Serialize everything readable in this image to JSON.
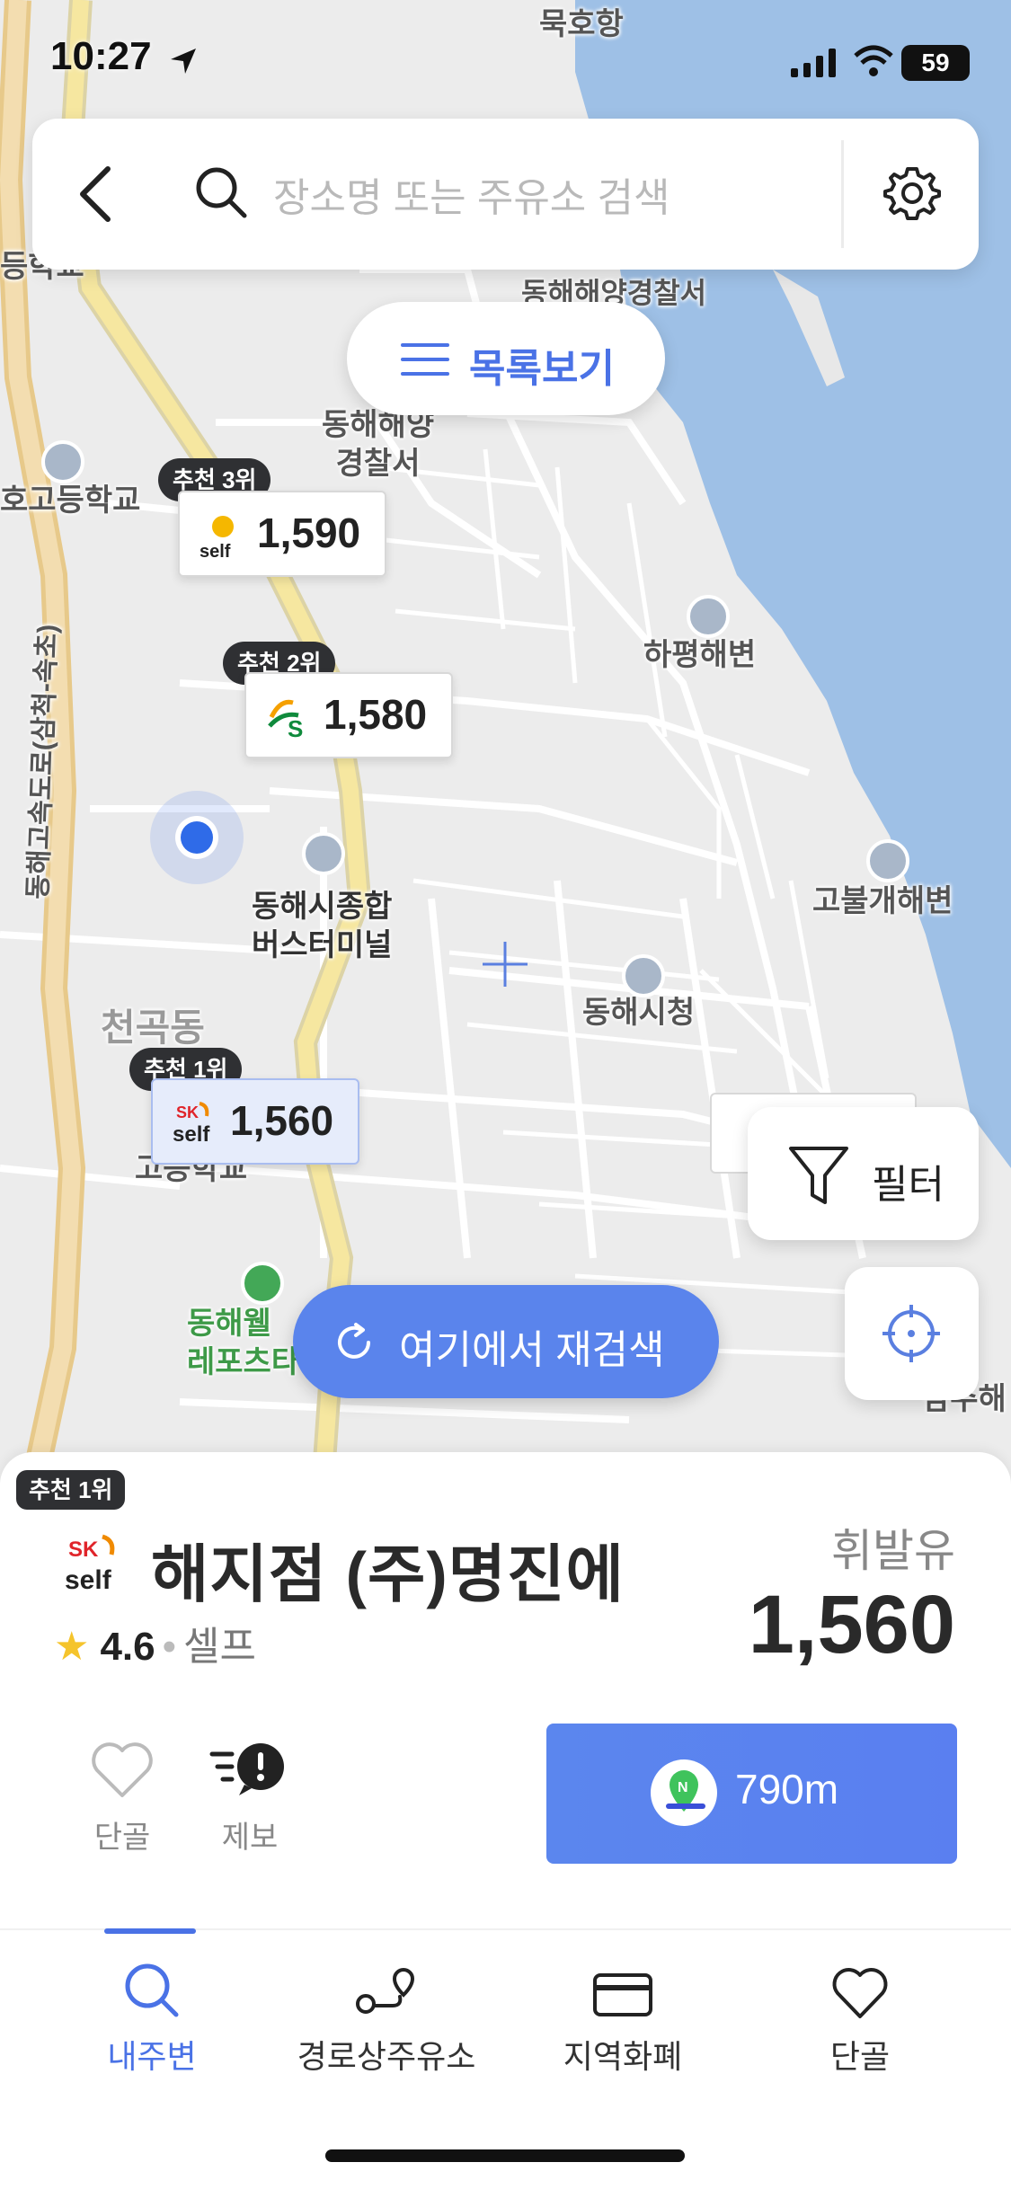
{
  "status_bar": {
    "time": "10:27",
    "battery": "59"
  },
  "search": {
    "placeholder": "장소명 또는 주유소 검색"
  },
  "list_button": {
    "label": "목록보기"
  },
  "map": {
    "labels": [
      {
        "text": "묵호항"
      },
      {
        "text": "동해해양경찰서"
      },
      {
        "text": "동해해양\n경찰서"
      },
      {
        "text": "호고등학교"
      },
      {
        "text": "하평해변"
      },
      {
        "text": "고불개해변"
      },
      {
        "text": "동해시종합\n버스터미널"
      },
      {
        "text": "동해시청"
      },
      {
        "text": "천곡동"
      },
      {
        "text": "고등학교"
      },
      {
        "text": "동해웰\n레포츠타"
      },
      {
        "text": "동해고속도로(삼척-속초)"
      },
      {
        "text": "등학교"
      },
      {
        "text": "삼주해"
      }
    ],
    "stations": [
      {
        "rank": "추천 3위",
        "price": "1,590",
        "brand": "S-OIL self"
      },
      {
        "rank": "추천 2위",
        "price": "1,580",
        "brand": "GS"
      },
      {
        "rank": "추천 1위",
        "price": "1,560",
        "brand": "SK self"
      }
    ]
  },
  "filter_button": {
    "label": "필터"
  },
  "research_button": {
    "label": "여기에서 재검색"
  },
  "detail": {
    "rank_tag": "추천 1위",
    "name": "해지점          (주)명진에",
    "rating": "4.6",
    "type": "셀프",
    "fuel": "휘발유",
    "price": "1,560",
    "distance": "790m",
    "favorite_label": "단골",
    "report_label": "제보"
  },
  "tabs": [
    {
      "label": "내주변",
      "active": true
    },
    {
      "label": "경로상주유소",
      "active": false
    },
    {
      "label": "지역화폐",
      "active": false
    },
    {
      "label": "단골",
      "active": false
    }
  ],
  "colors": {
    "accent": "#4a72e6",
    "button_blue": "#5a84ec",
    "sea": "#9ec0e6",
    "road_yellow": "#f6e7a0"
  }
}
